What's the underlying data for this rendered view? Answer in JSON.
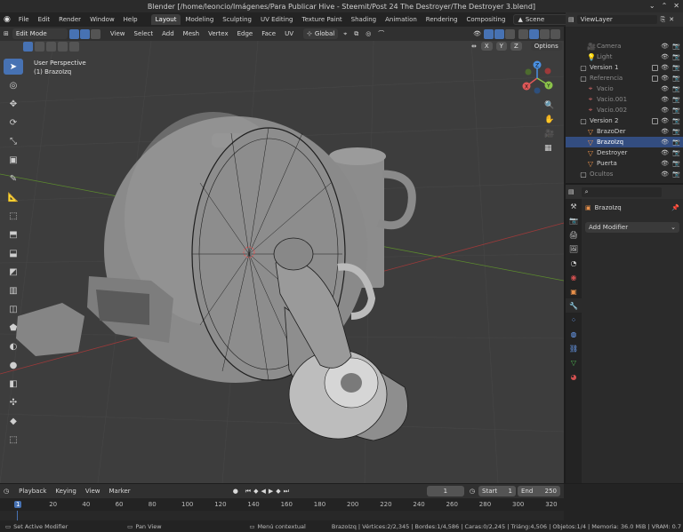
{
  "window": {
    "title": "Blender [/home/leoncio/Imágenes/Para Publicar Hive - Steemit/Post 24 The Destroyer/The Destroyer 3.blend]"
  },
  "menu": [
    "File",
    "Edit",
    "Render",
    "Window",
    "Help"
  ],
  "workspaces": [
    "Layout",
    "Modeling",
    "Sculpting",
    "UV Editing",
    "Texture Paint",
    "Shading",
    "Animation",
    "Rendering",
    "Compositing"
  ],
  "scene": "Scene",
  "view_layer": "ViewLayer",
  "viewport_header": {
    "mode": "Edit Mode",
    "menus": [
      "View",
      "Select",
      "Add",
      "Mesh",
      "Vertex",
      "Edge",
      "Face",
      "UV"
    ],
    "orientation": "Global",
    "options": "Options",
    "axes": [
      "X",
      "Y",
      "Z"
    ]
  },
  "viewport": {
    "perspective": "User Perspective",
    "object": "(1) BrazoIzq"
  },
  "outliner": {
    "items": [
      {
        "label": "Camera",
        "indent": 3,
        "icon": "camera-icon",
        "color": "#9b7a55",
        "dim": true
      },
      {
        "label": "Light",
        "indent": 3,
        "icon": "light-icon",
        "color": "#9b7a55",
        "dim": true
      },
      {
        "label": "Version 1",
        "indent": 2,
        "icon": "collection-icon",
        "color": "#cfcfcf",
        "dim": false,
        "check": true
      },
      {
        "label": "Referencia",
        "indent": 2,
        "icon": "collection-icon",
        "color": "#cfcfcf",
        "dim": true,
        "check": true
      },
      {
        "label": "Vacio",
        "indent": 3,
        "icon": "empty-icon",
        "color": "#cc6666",
        "dim": true
      },
      {
        "label": "Vacio.001",
        "indent": 3,
        "icon": "empty-icon",
        "color": "#cc6666",
        "dim": true
      },
      {
        "label": "Vacio.002",
        "indent": 3,
        "icon": "empty-icon",
        "color": "#cc6666",
        "dim": true
      },
      {
        "label": "Version 2",
        "indent": 2,
        "icon": "collection-icon",
        "color": "#cfcfcf",
        "dim": false,
        "check": true
      },
      {
        "label": "BrazoDer",
        "indent": 3,
        "icon": "mesh-icon",
        "color": "#e8904a",
        "dim": false
      },
      {
        "label": "BrazoIzq",
        "indent": 3,
        "icon": "mesh-icon",
        "color": "#e8904a",
        "dim": false,
        "selected": true
      },
      {
        "label": "Destroyer",
        "indent": 3,
        "icon": "mesh-icon",
        "color": "#e8904a",
        "dim": false
      },
      {
        "label": "Puerta",
        "indent": 3,
        "icon": "mesh-icon",
        "color": "#e8904a",
        "dim": false
      },
      {
        "label": "Ocultos",
        "indent": 2,
        "icon": "collection-icon",
        "color": "#cfcfcf",
        "dim": true
      }
    ]
  },
  "properties": {
    "object": "BrazoIzq",
    "add_modifier": "Add Modifier"
  },
  "timeline": {
    "menus": [
      "Playback",
      "Keying",
      "View",
      "Marker"
    ],
    "current_frame": "1",
    "start_label": "Start",
    "start": "1",
    "end_label": "End",
    "end": "250",
    "ticks": [
      "1",
      "20",
      "40",
      "60",
      "80",
      "100",
      "120",
      "140",
      "160",
      "180",
      "200",
      "220",
      "240",
      "260",
      "280",
      "300",
      "320"
    ]
  },
  "status": {
    "left1": "Set Active Modifier",
    "left2": "Pan View",
    "left3": "Menú contextual",
    "stats": "BrazoIzq | Vértices:2/2,345 | Bordes:1/4,586 | Caras:0/2,245 | Triáng:4,506 | Objetos:1/4 | Memoria: 36.0 MiB | VRAM: 0.7"
  },
  "colors": {
    "accent": "#4772b3",
    "mesh": "#e8904a",
    "x_axis": "#e05858",
    "y_axis": "#8bc34a",
    "z_axis": "#4a90e2"
  }
}
